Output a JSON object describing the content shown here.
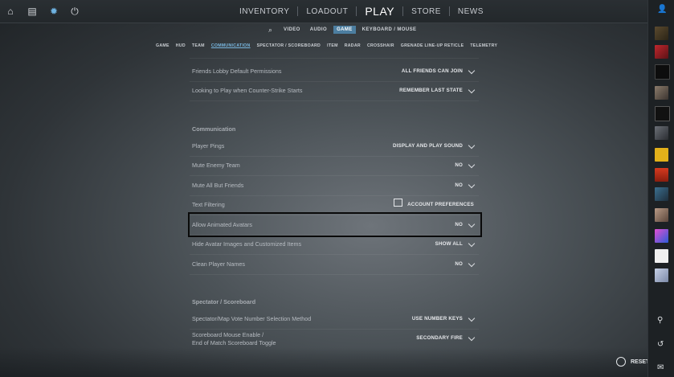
{
  "header": {
    "nav": [
      "INVENTORY",
      "LOADOUT",
      "PLAY",
      "STORE",
      "NEWS"
    ],
    "icons": [
      "home-icon",
      "database-icon",
      "settings-icon",
      "power-icon"
    ]
  },
  "subnav": {
    "items": [
      "VIDEO",
      "AUDIO",
      "GAME",
      "KEYBOARD / MOUSE"
    ],
    "active": "GAME"
  },
  "tabs": {
    "items": [
      "GAME",
      "HUD",
      "TEAM",
      "COMMUNICATION",
      "SPECTATOR / SCOREBOARD",
      "ITEM",
      "RADAR",
      "CROSSHAIR",
      "GRENADE LINE-UP RETICLE",
      "TELEMETRY"
    ],
    "active": "COMMUNICATION"
  },
  "rows": [
    {
      "label": "Friends Lobby Default Permissions",
      "value": "ALL FRIENDS CAN JOIN"
    },
    {
      "label": "Looking to Play when Counter-Strike Starts",
      "value": "REMEMBER LAST STATE"
    }
  ],
  "communication": {
    "title": "Communication",
    "rows": [
      {
        "label": "Player Pings",
        "value": "DISPLAY AND PLAY SOUND"
      },
      {
        "label": "Mute Enemy Team",
        "value": "NO"
      },
      {
        "label": "Mute All But Friends",
        "value": "NO"
      },
      {
        "label": "Text Filtering",
        "value": "ACCOUNT PREFERENCES"
      },
      {
        "label": "Allow Animated Avatars",
        "value": "NO"
      },
      {
        "label": "Hide Avatar Images and Customized Items",
        "value": "SHOW ALL"
      },
      {
        "label": "Clean Player Names",
        "value": "NO"
      }
    ]
  },
  "spectator": {
    "title": "Spectator / Scoreboard",
    "rows": [
      {
        "label": "Spectator/Map Vote Number Selection Method",
        "value": "USE NUMBER KEYS"
      },
      {
        "label": "Scoreboard Mouse Enable /",
        "label2": "End of Match Scoreboard Toggle",
        "value": "SECONDARY FIRE"
      }
    ]
  },
  "footer": {
    "reset_label": "RESET"
  },
  "colors": {
    "accent": "#4c7ea0",
    "tab_active": "#79b7e0"
  }
}
